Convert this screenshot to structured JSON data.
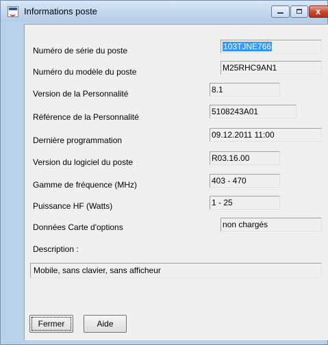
{
  "window": {
    "title": "Informations poste",
    "controls": {
      "minimize": "minimize",
      "maximize": "maximize",
      "close": "x"
    }
  },
  "fields": [
    {
      "label": "Numéro de série du poste",
      "value": "103TJNE766",
      "selected": true
    },
    {
      "label": "Numéro du modèle du poste",
      "value": "M25RHC9AN1"
    },
    {
      "label": "Version de la Personnalité",
      "value": "8.1"
    },
    {
      "label": "Référence de la Personnalité",
      "value": "5108243A01"
    },
    {
      "label": "Dernière programmation",
      "value": "09.12.2011 11:00"
    },
    {
      "label": "Version du logiciel du poste",
      "value": "R03.16.00"
    },
    {
      "label": "Gamme de fréquence (MHz)",
      "value": "403 - 470"
    },
    {
      "label": "Puissance HF (Watts)",
      "value": "1 - 25"
    },
    {
      "label": "Données Carte d'options",
      "value": "non chargés"
    }
  ],
  "description": {
    "label": "Description :",
    "value": "Mobile, sans clavier, sans afficheur"
  },
  "buttons": {
    "close_label": "Fermer",
    "help_label": "Aide"
  },
  "icons": {
    "app": "doc-icon",
    "minimize": "minimize-icon",
    "maximize": "maximize-icon",
    "close": "close-icon"
  }
}
